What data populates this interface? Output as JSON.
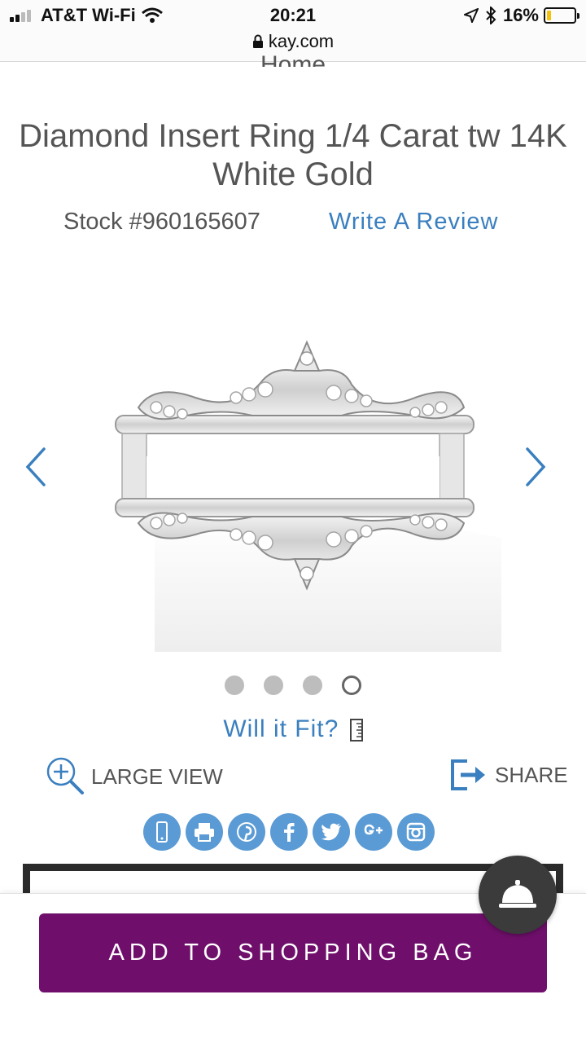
{
  "status_bar": {
    "carrier": "AT&T Wi-Fi",
    "time": "20:21",
    "url": "kay.com",
    "battery": "16%",
    "battery_level": 0.16
  },
  "page": {
    "breadcrumb": "Home",
    "title_line1": "Diamond Insert Ring 1/4 Carat tw 14K",
    "title_line2": "White Gold",
    "stock": "Stock #960165607",
    "write_review": "Write A Review",
    "will_it_fit": "Will it Fit?",
    "large_view": "LARGE VIEW",
    "share": "SHARE",
    "add_to_bag": "ADD TO SHOPPING BAG"
  },
  "gallery": {
    "slide_count": 4,
    "active_slide": 4
  },
  "social_icons": [
    "mobile-icon",
    "print-icon",
    "pinterest-icon",
    "facebook-icon",
    "twitter-icon",
    "google-plus-icon",
    "instagram-icon"
  ],
  "colors": {
    "link_blue": "#3a7fbf",
    "cta_purple": "#6f0f6b",
    "social_blue": "#5b9bd5"
  }
}
